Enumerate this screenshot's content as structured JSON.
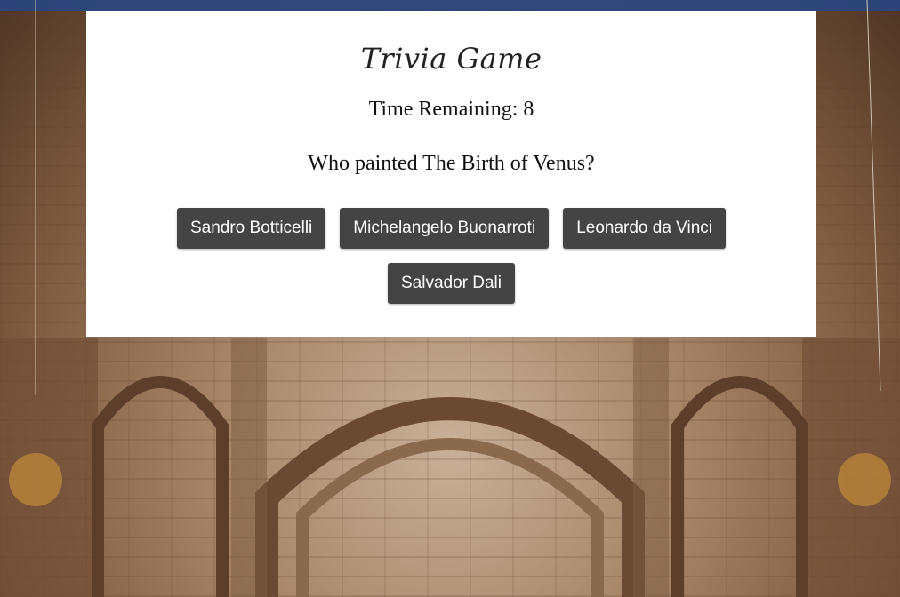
{
  "game": {
    "title": "Trivia Game",
    "timer_text": "Time Remaining: 8",
    "question": "Who painted The Birth of Venus?",
    "answers": [
      "Sandro Botticelli",
      "Michelangelo Buonarroti",
      "Leonardo da Vinci",
      "Salvador Dali"
    ]
  },
  "colors": {
    "card_bg": "#ffffff",
    "button_bg": "#444444",
    "button_text": "#ffffff"
  }
}
